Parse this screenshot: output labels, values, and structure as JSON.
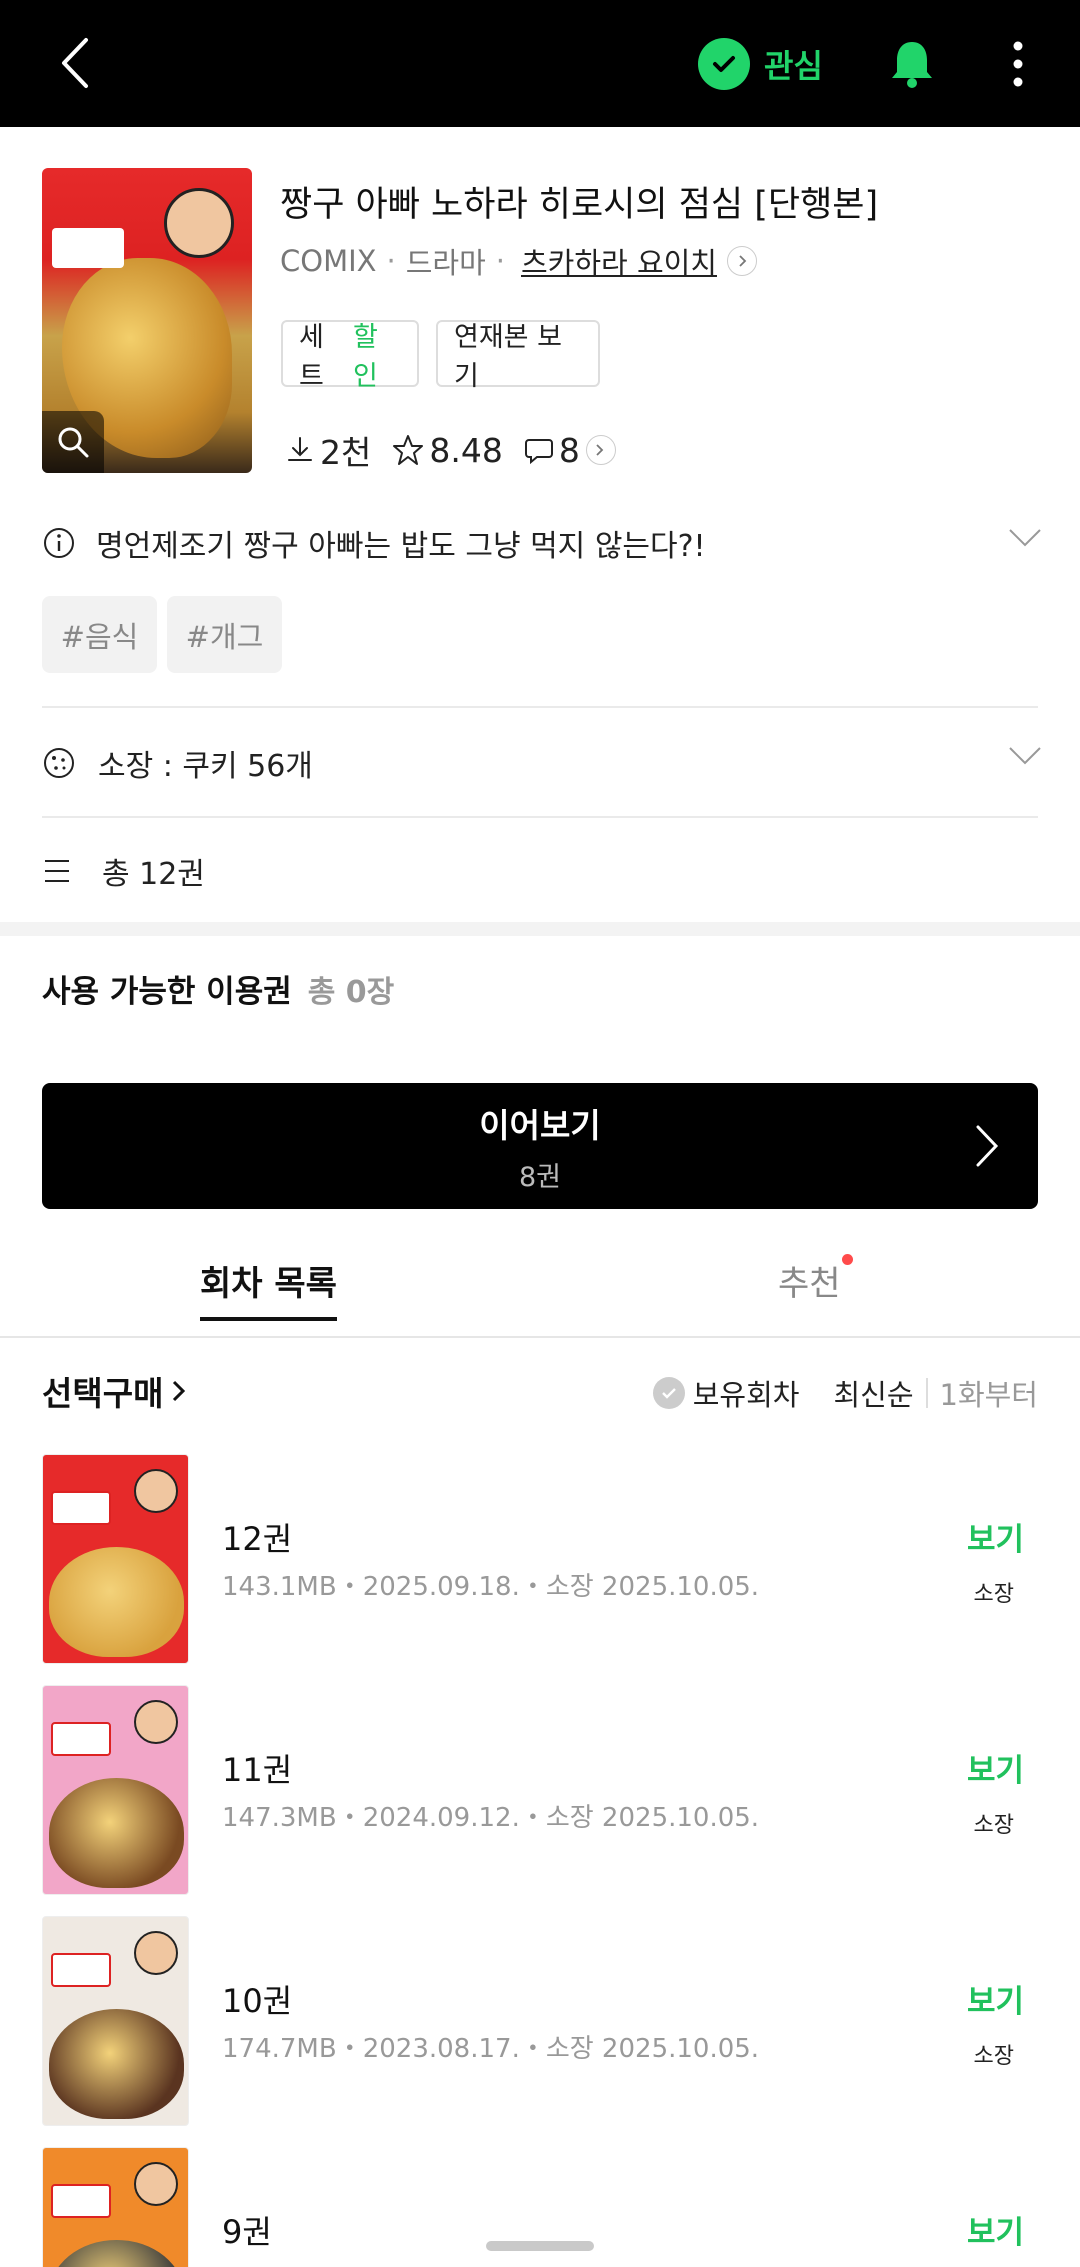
{
  "topbar": {
    "favorite_label": "관심",
    "icons": [
      "back-arrow-icon",
      "check-icon",
      "bell-icon",
      "more-vertical-icon"
    ],
    "accent_color": "#21d46a"
  },
  "book": {
    "title": "짱구 아빠 노하라 히로시의 점심 [단행본]",
    "publisher": "COMIX",
    "genre": "드라마",
    "author": "츠카하라 요이치",
    "set_label": "세트",
    "set_discount": "할인",
    "serial_label": "연재본 보기",
    "downloads": "2천",
    "rating": "8.48",
    "comments": "8"
  },
  "description": "명언제조기 짱구 아빠는 밥도 그냥 먹지 않는다?!",
  "tags": [
    "#음식",
    "#개그"
  ],
  "owned": "소장 : 쿠키 56개",
  "total": "총 12권",
  "pass": {
    "label": "사용 가능한 이용권",
    "count": "총 0장"
  },
  "continue": {
    "label": "이어보기",
    "sub": "8권"
  },
  "tabs": [
    {
      "label": "회차 목록",
      "active": true
    },
    {
      "label": "추천",
      "active": false,
      "has_dot": true
    }
  ],
  "list_header": {
    "select_buy": "선택구매",
    "owned_filter": "보유회차",
    "sort_latest": "최신순",
    "sort_first": "1화부터"
  },
  "episodes": [
    {
      "volume": "12권",
      "meta": "143.1MB・2025.09.18.・소장 2025.10.05.",
      "action": "보기",
      "status": "소장",
      "cover_color": "#e62a2a",
      "food_color": "#d9a23e"
    },
    {
      "volume": "11권",
      "meta": "147.3MB・2024.09.12.・소장 2025.10.05.",
      "action": "보기",
      "status": "소장",
      "cover_color": "#f2a6c8",
      "food_color": "#7a4a22"
    },
    {
      "volume": "10권",
      "meta": "174.7MB・2023.08.17.・소장 2025.10.05.",
      "action": "보기",
      "status": "소장",
      "cover_color": "#efe9e2",
      "food_color": "#5a3420"
    },
    {
      "volume": "9권",
      "meta": "",
      "action": "보기",
      "status": "",
      "cover_color": "#f08a2a",
      "food_color": "#3a3a3a"
    }
  ]
}
